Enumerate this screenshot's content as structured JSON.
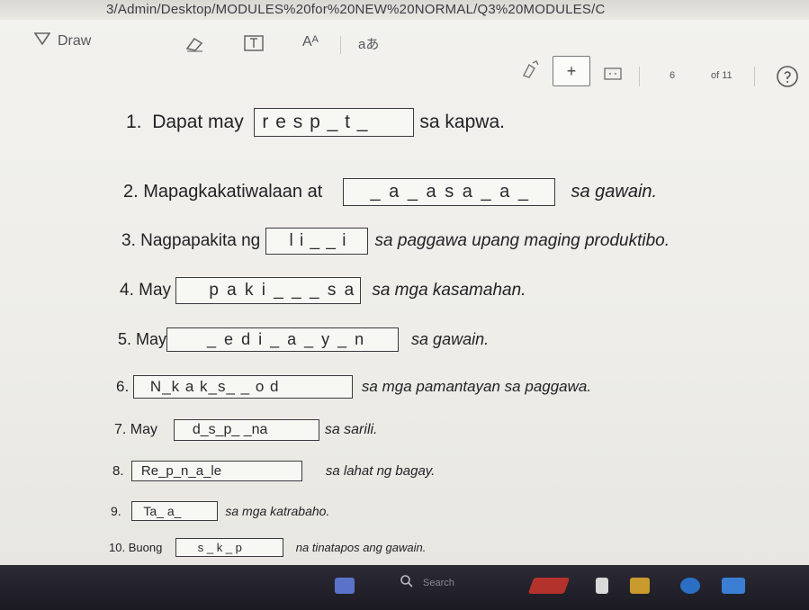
{
  "browser": {
    "url": "3/Admin/Desktop/MODULES%20for%20NEW%20NORMAL/Q3%20MODULES/C"
  },
  "toolbar": {
    "draw_label": "Draw",
    "text_size_label": "Aᴬ",
    "read_aloud_label": "aあ",
    "add_label": "+",
    "page_current": "6",
    "page_total": "of 11",
    "icons": [
      "filter-icon",
      "eraser-icon",
      "text-box-icon",
      "text-size-icon",
      "read-aloud-icon",
      "highlight-icon",
      "add-note-icon",
      "fit-page-icon",
      "help-icon"
    ]
  },
  "worksheet": {
    "items": [
      {
        "num": "1.",
        "pre": "Dapat may",
        "box": "r e s p _ t _",
        "post": "sa kapwa."
      },
      {
        "num": "2.",
        "pre": "Mapagkakatiwalaan at",
        "box": "_ a _ a s a _ a _",
        "post": "sa gawain."
      },
      {
        "num": "3.",
        "pre": "Nagpapakita ng",
        "box": "l i _ _ i",
        "post": "sa paggawa upang maging produktibo."
      },
      {
        "num": "4.",
        "pre": "May",
        "box": "p a k i _ _ _ s a",
        "post": "sa mga kasamahan."
      },
      {
        "num": "5.",
        "pre": "May",
        "box": "_ e d i _ a _ y _ n",
        "post": "sa gawain."
      },
      {
        "num": "6.",
        "pre": "",
        "box": "N_k a k_s_ _ o d",
        "post": "sa mga pamantayan sa paggawa."
      },
      {
        "num": "7.",
        "pre": "May",
        "box": "d_s_p_ _na",
        "post": "sa sarili."
      },
      {
        "num": "8.",
        "pre": "",
        "box": "Re_p_n_a_le",
        "post": "sa lahat ng bagay."
      },
      {
        "num": "9.",
        "pre": "",
        "box": "Ta_ a_",
        "post": "sa mga katrabaho."
      },
      {
        "num": "10.",
        "pre": "Buong",
        "box": "s _ k _ p",
        "post": "na tinatapos ang gawain."
      }
    ]
  },
  "taskbar": {
    "search_placeholder": "Search",
    "apps": [
      "task-view-icon",
      "search-icon",
      "file-explorer-icon",
      "cursor-icon",
      "files-icon",
      "browser-icon",
      "store-icon"
    ]
  }
}
